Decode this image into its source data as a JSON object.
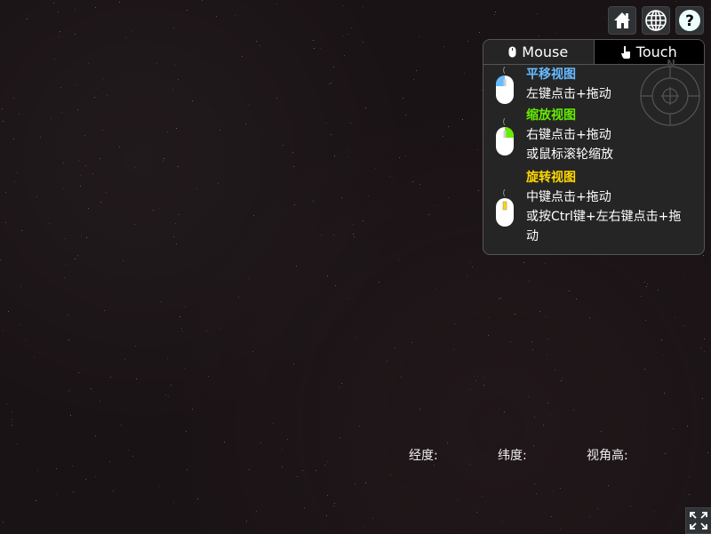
{
  "toolbar": {
    "home": "home-icon",
    "globe": "globe-icon",
    "help": "help-icon"
  },
  "help_panel": {
    "tabs": [
      {
        "label": "Mouse"
      },
      {
        "label": "Touch"
      }
    ],
    "compass_label": "N",
    "pan": {
      "title": "平移视图",
      "line1": "左键点击+拖动",
      "color": "#66bbff"
    },
    "zoom": {
      "title": "缩放视图",
      "line1": "右键点击+拖动",
      "line2": "或鼠标滚轮缩放",
      "color": "#65ec00"
    },
    "rotate": {
      "title": "旋转视图",
      "line1": "中键点击+拖动",
      "line2": "或按Ctrl键+左右键点击+拖",
      "line3": "动",
      "color": "#ffd800"
    }
  },
  "status": {
    "lon_label": "经度:",
    "lat_label": "纬度:",
    "height_label": "视角高:"
  },
  "fullscreen": "fullscreen-icon"
}
